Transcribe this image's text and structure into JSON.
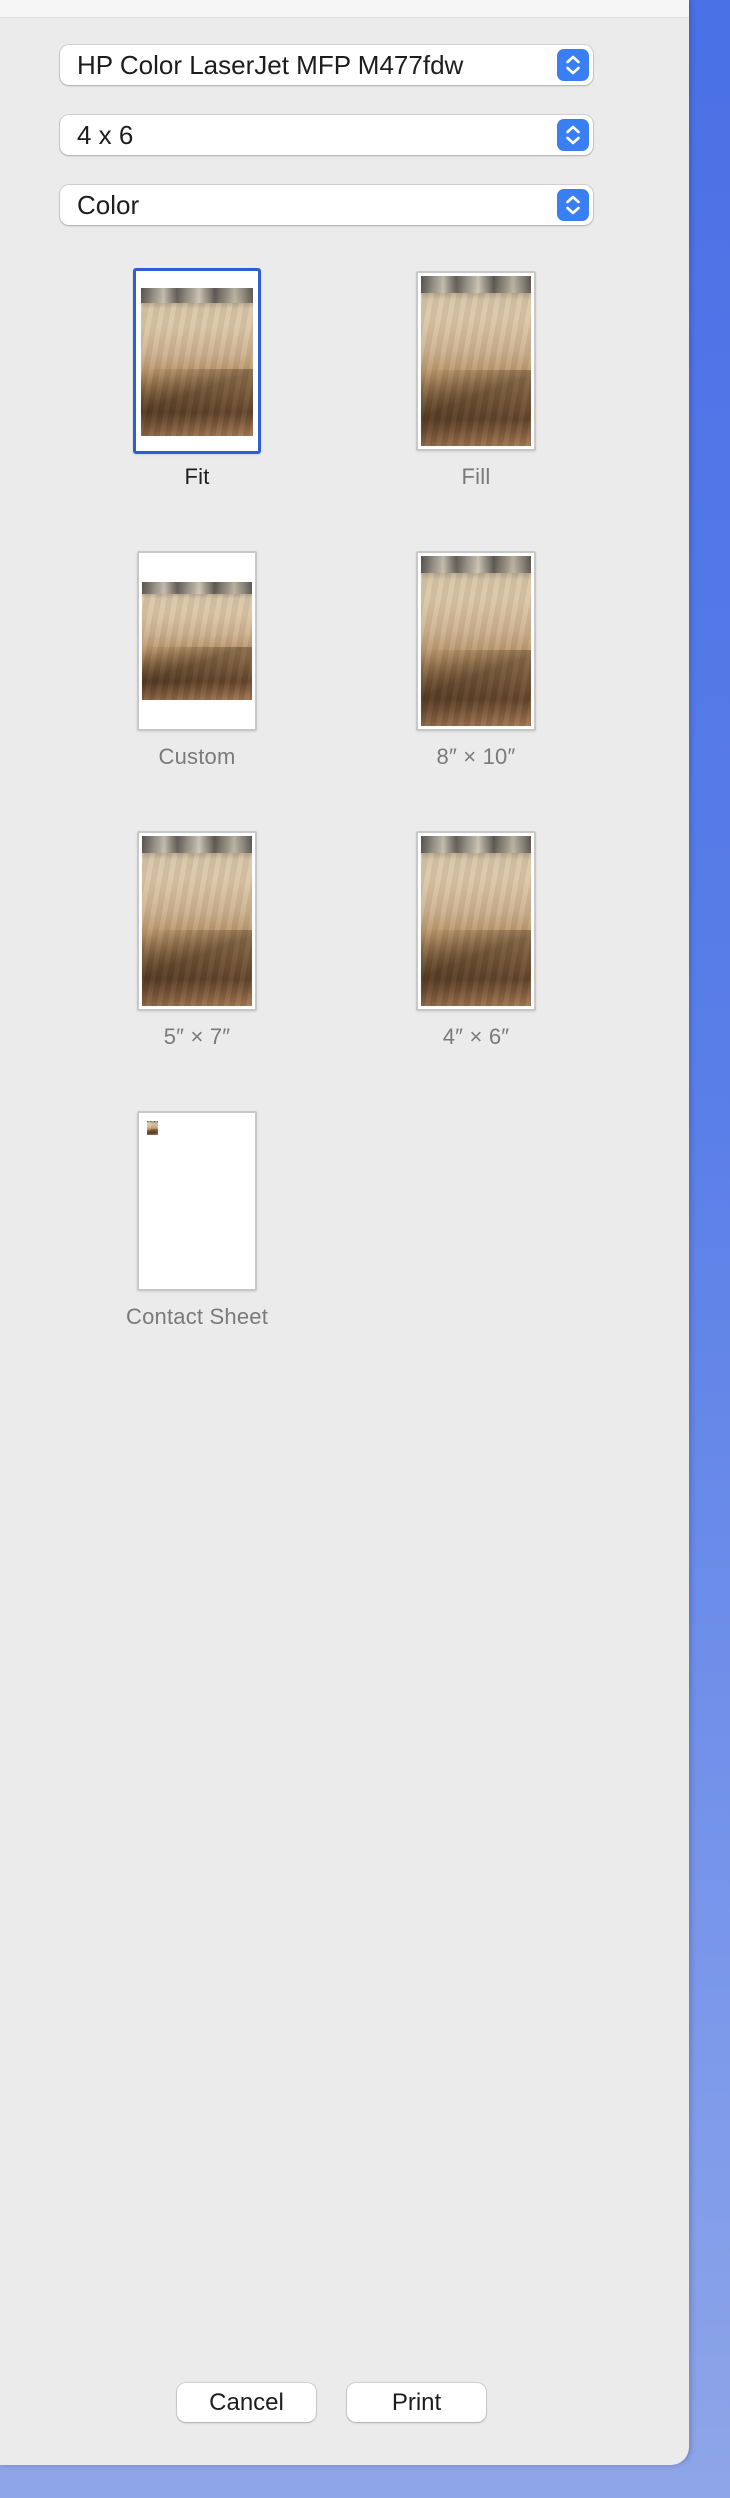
{
  "printer": {
    "selected": "HP Color LaserJet MFP M477fdw"
  },
  "paper_size": {
    "selected": "4 x 6"
  },
  "color_mode": {
    "selected": "Color"
  },
  "layouts": [
    {
      "label": "Fit",
      "selected": true
    },
    {
      "label": "Fill",
      "selected": false
    },
    {
      "label": "Custom",
      "selected": false
    },
    {
      "label": "8″ × 10″",
      "selected": false
    },
    {
      "label": "5″ × 7″",
      "selected": false
    },
    {
      "label": "4″ × 6″",
      "selected": false
    },
    {
      "label": "Contact Sheet",
      "selected": false
    }
  ],
  "buttons": {
    "cancel": "Cancel",
    "print": "Print"
  },
  "colors": {
    "accent": "#3a7ef3",
    "selection": "#2c5fd6"
  },
  "icons": {
    "popup_stepper": "up-down-chevron-icon"
  }
}
